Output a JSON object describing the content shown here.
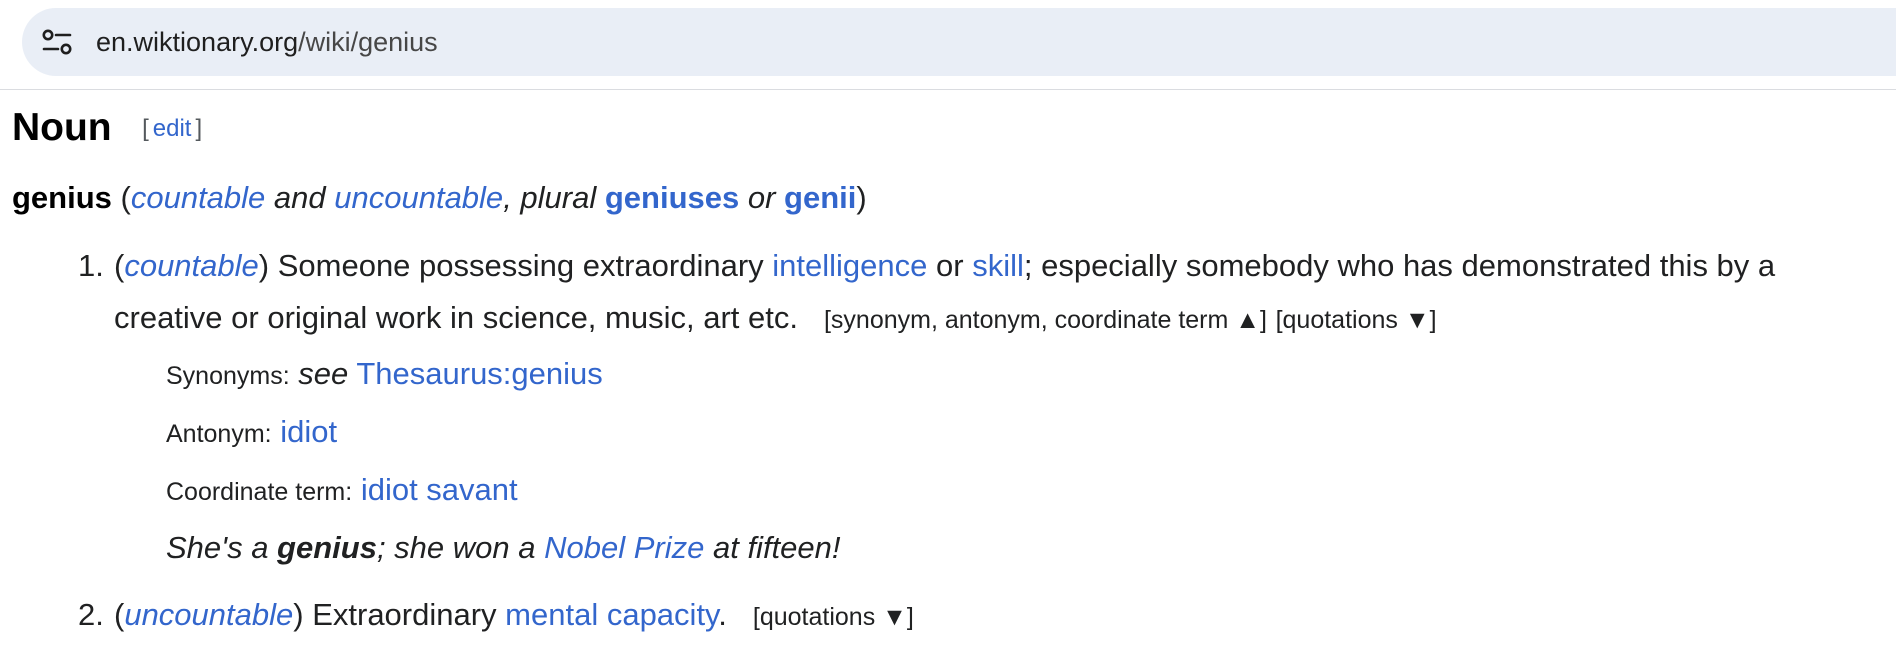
{
  "browser": {
    "url_domain": "en.wiktionary.org",
    "url_path": "/wiki/genius",
    "site_info_icon": "tune-icon"
  },
  "section": {
    "heading": "Noun",
    "edit_bracket_open": "[",
    "edit_label": "edit",
    "edit_bracket_close": "]"
  },
  "headword": {
    "word": "genius",
    "open_paren": " (",
    "countable": "countable",
    "and": " and ",
    "uncountable": "uncountable",
    "comma_plural": ", plural ",
    "plural1": "geniuses",
    "or": " or ",
    "plural2": "genii",
    "close_paren": ")"
  },
  "senses": [
    {
      "number": "1.",
      "open_paren": "(",
      "label": "countable",
      "close_paren": ")",
      "text_a": " Someone possessing extraordinary ",
      "link_intelligence": "intelligence",
      "text_or": " or ",
      "link_skill": "skill",
      "text_b": "; especially somebody who has demonstrated this by a creative or original work in science, music, art etc.",
      "toggle_nyms": "[synonym, antonym, coordinate term ▲]",
      "toggle_quotes": "[quotations ▼]",
      "synonyms_label": "Synonyms:",
      "synonyms_see": "see",
      "synonyms_link": "Thesaurus:genius",
      "antonym_label": "Antonym:",
      "antonym_link": "idiot",
      "coord_label": "Coordinate term:",
      "coord_link": "idiot savant",
      "example_pre": "She's a ",
      "example_bold": "genius",
      "example_mid": "; she won a ",
      "example_link": "Nobel Prize",
      "example_post": " at fifteen!"
    },
    {
      "number": "2.",
      "open_paren": "(",
      "label": "uncountable",
      "close_paren": ")",
      "text_a": " Extraordinary ",
      "link": "mental capacity",
      "text_b": ".",
      "toggle_quotes": "[quotations ▼]"
    }
  ]
}
